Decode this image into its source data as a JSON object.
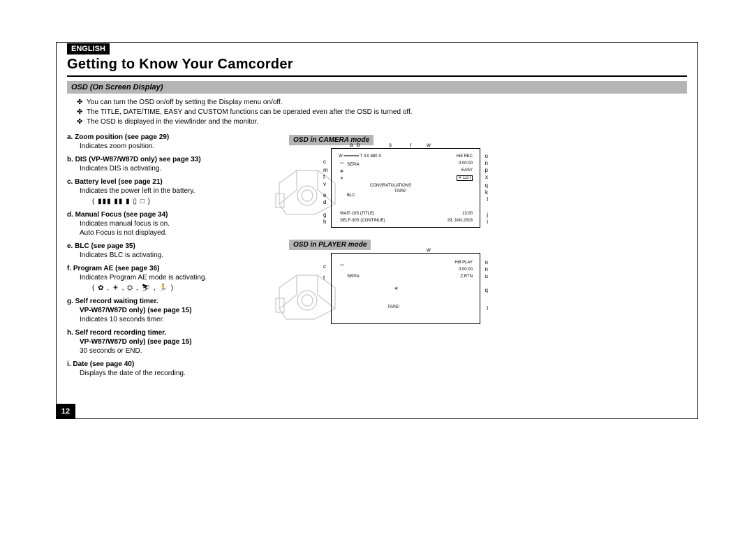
{
  "language_tag": "ENGLISH",
  "title": "Getting to Know Your Camcorder",
  "section_heading": "OSD (On Screen Display)",
  "intro_bullets": [
    "You can turn the OSD on/off by setting the Display menu on/off.",
    "The TITLE, DATE/TIME, EASY and CUSTOM functions can be operated even after the OSD is turned off.",
    "The OSD is displayed in the viewfinder and the monitor."
  ],
  "items": [
    {
      "letter": "a.",
      "bold": "Zoom position (see page 29)",
      "rest": "Indicates zoom position."
    },
    {
      "letter": "b.",
      "bold": "DIS (VP-W87/W87D only) see page 33)",
      "rest": "Indicates DIS is activating."
    },
    {
      "letter": "c.",
      "bold": "Battery level (see page 21)",
      "rest": "Indicates the power left in the battery."
    },
    {
      "letter": "d.",
      "bold": "Manual Focus (see page 34)",
      "rest": "Indicates manual focus is on.\nAuto Focus is not displayed."
    },
    {
      "letter": "e.",
      "bold": "BLC (see page 35)",
      "rest": "Indicates BLC is activating."
    },
    {
      "letter": "f.",
      "bold": "Program AE (see page 36)",
      "rest": "Indicates Program AE mode is activating."
    },
    {
      "letter": "g.",
      "bold": "Self record waiting timer.\nVP-W87/W87D only) (see page 15)",
      "rest": "Indicates 10 seconds timer."
    },
    {
      "letter": "h.",
      "bold": "Self record recording timer.\nVP-W87/W87D only) (see page 15)",
      "rest": "30 seconds or END."
    },
    {
      "letter": "i.",
      "bold": "Date (see page 40)",
      "rest": "Displays the date of the recording."
    }
  ],
  "battery_icons": "( ▮▮▮ ▮▮  ▮   ▯   □ )",
  "ae_icons": "( ✿ , ☀ , ⛭ , ⛷ , 🏃 )",
  "cam_head": "OSD in CAMERA mode",
  "play_head": "OSD in PLAYER mode",
  "cam_top_labels": {
    "a": "a",
    "b": "b",
    "s": "s",
    "r": "r",
    "w": "w"
  },
  "cam_left_labels": [
    "c",
    "m",
    "f",
    "v",
    "e",
    "d",
    "g",
    "h"
  ],
  "cam_right_labels": [
    "o",
    "n",
    "p",
    "x",
    "q",
    "k",
    "l",
    "j",
    "i"
  ],
  "cam_inner": {
    "wt": "W ━━━━━━ T   XX   880 X",
    "hi8": "Hi8   REC",
    "time1": "0:00:00",
    "easy": "EASY",
    "sepia": "SEPIA",
    "light": "☀ LGT",
    "mf": "✲",
    "congrats": "CONGRATULATIONS",
    "tape": "TAPE!",
    "blc": "BLC",
    "wait": "WAIT-10S (TITLE)",
    "self": "SELF-30S (CONTINUE)",
    "clock": "13:00",
    "date": "29. JAN.2003"
  },
  "play_left_labels": [
    "c",
    "t"
  ],
  "play_right_labels": [
    "o",
    "n",
    "u",
    "q",
    "l"
  ],
  "play_inner": {
    "hi8": "Hi8   PLAY",
    "time": "0:00:00",
    "zrtn": "Z.RTN",
    "sepia": "SEPIA",
    "tape": "TAPE!",
    "w": "w"
  },
  "page_number": "12"
}
